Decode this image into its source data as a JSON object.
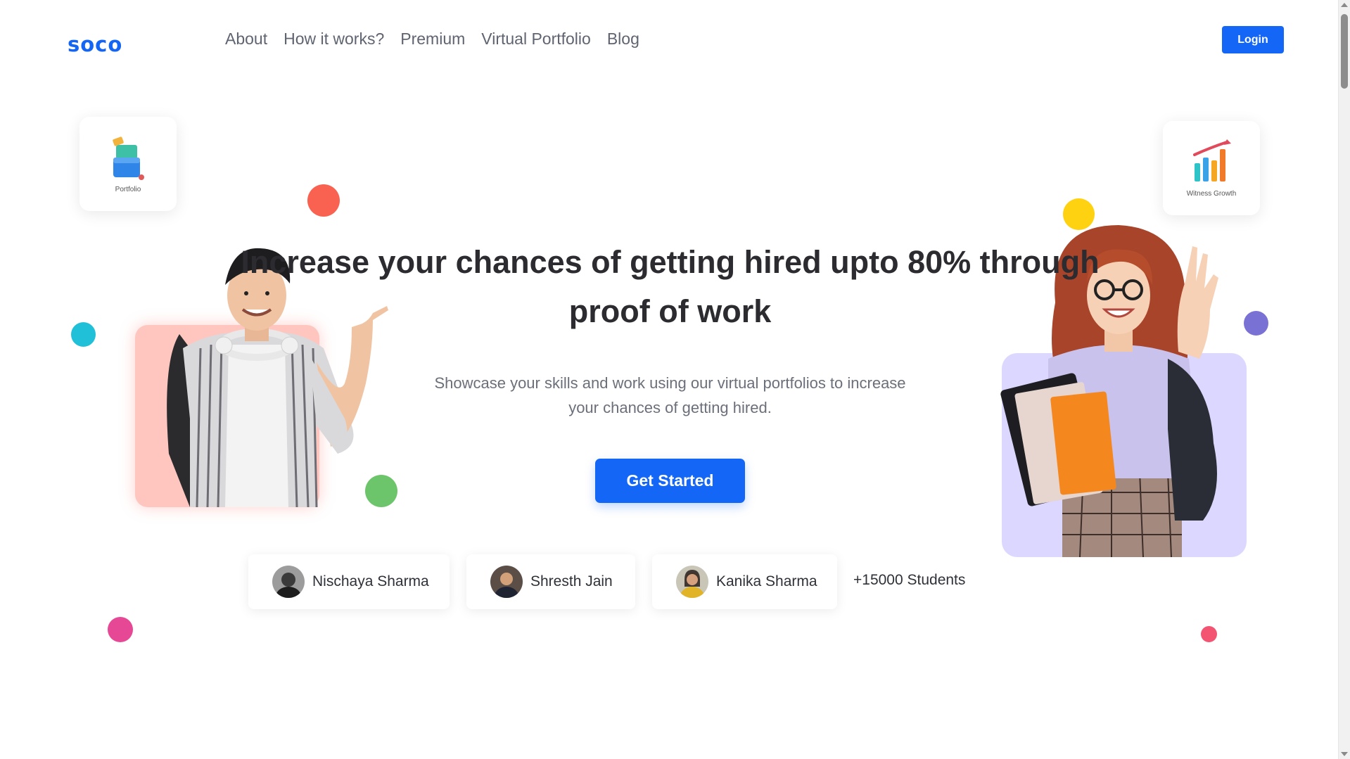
{
  "header": {
    "logo": "soco",
    "nav": [
      "About",
      "How it works?",
      "Premium",
      "Virtual Portfolio",
      "Blog"
    ],
    "login_label": "Login"
  },
  "cards": {
    "portfolio_label": "Portfolio",
    "growth_label": "Witness Growth"
  },
  "hero": {
    "headline_line1": "Increase your chances of getting hired upto 80% through",
    "headline_line2": "proof of work",
    "subtext_line1": "Showcase your skills and work using our virtual portfolios to increase",
    "subtext_line2": "your chances of getting hired.",
    "cta_label": "Get Started"
  },
  "testimonials": {
    "people": [
      "Nischaya Sharma",
      "Shresth Jain",
      "Kanika Sharma"
    ],
    "count_label": "+15000 Students"
  },
  "colors": {
    "brand": "#1366f6",
    "dot_red": "#f96250",
    "dot_yellow": "#ffd211",
    "dot_cyan": "#21c0d9",
    "dot_purple": "#7a71d5",
    "dot_green": "#6cc56a",
    "dot_pink": "#e64895",
    "dot_rose": "#f35471"
  }
}
